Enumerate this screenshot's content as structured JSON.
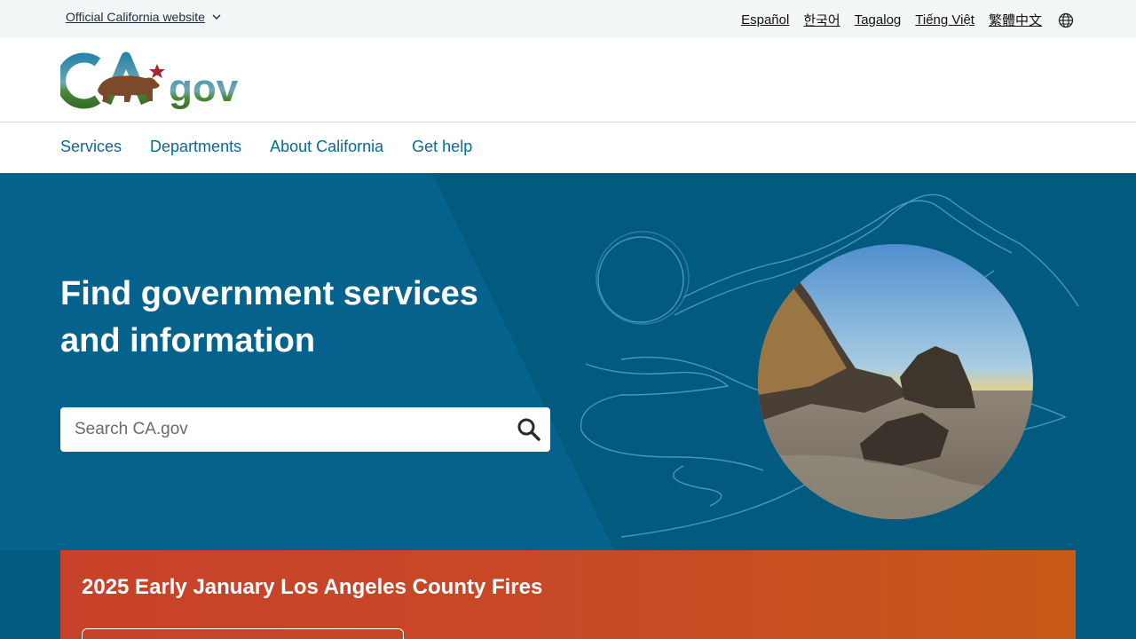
{
  "utility": {
    "official_label": "Official California website",
    "languages": [
      "Español",
      "한국어",
      "Tagalog",
      "Tiếng Việt",
      "繁體中文"
    ]
  },
  "branding": {
    "logo_text": "CA.gov"
  },
  "nav": {
    "items": [
      "Services",
      "Departments",
      "About California",
      "Get help"
    ]
  },
  "hero": {
    "title": "Find government services and information",
    "search_placeholder": "Search CA.gov"
  },
  "alert": {
    "title": "2025 Early January Los Angeles County Fires"
  },
  "colors": {
    "primary": "#046b99",
    "hero": "#035a7f",
    "alert": "#c8412a"
  },
  "icons": [
    "chevron-down-icon",
    "globe-icon",
    "search-icon",
    "bear-icon",
    "star-icon"
  ]
}
